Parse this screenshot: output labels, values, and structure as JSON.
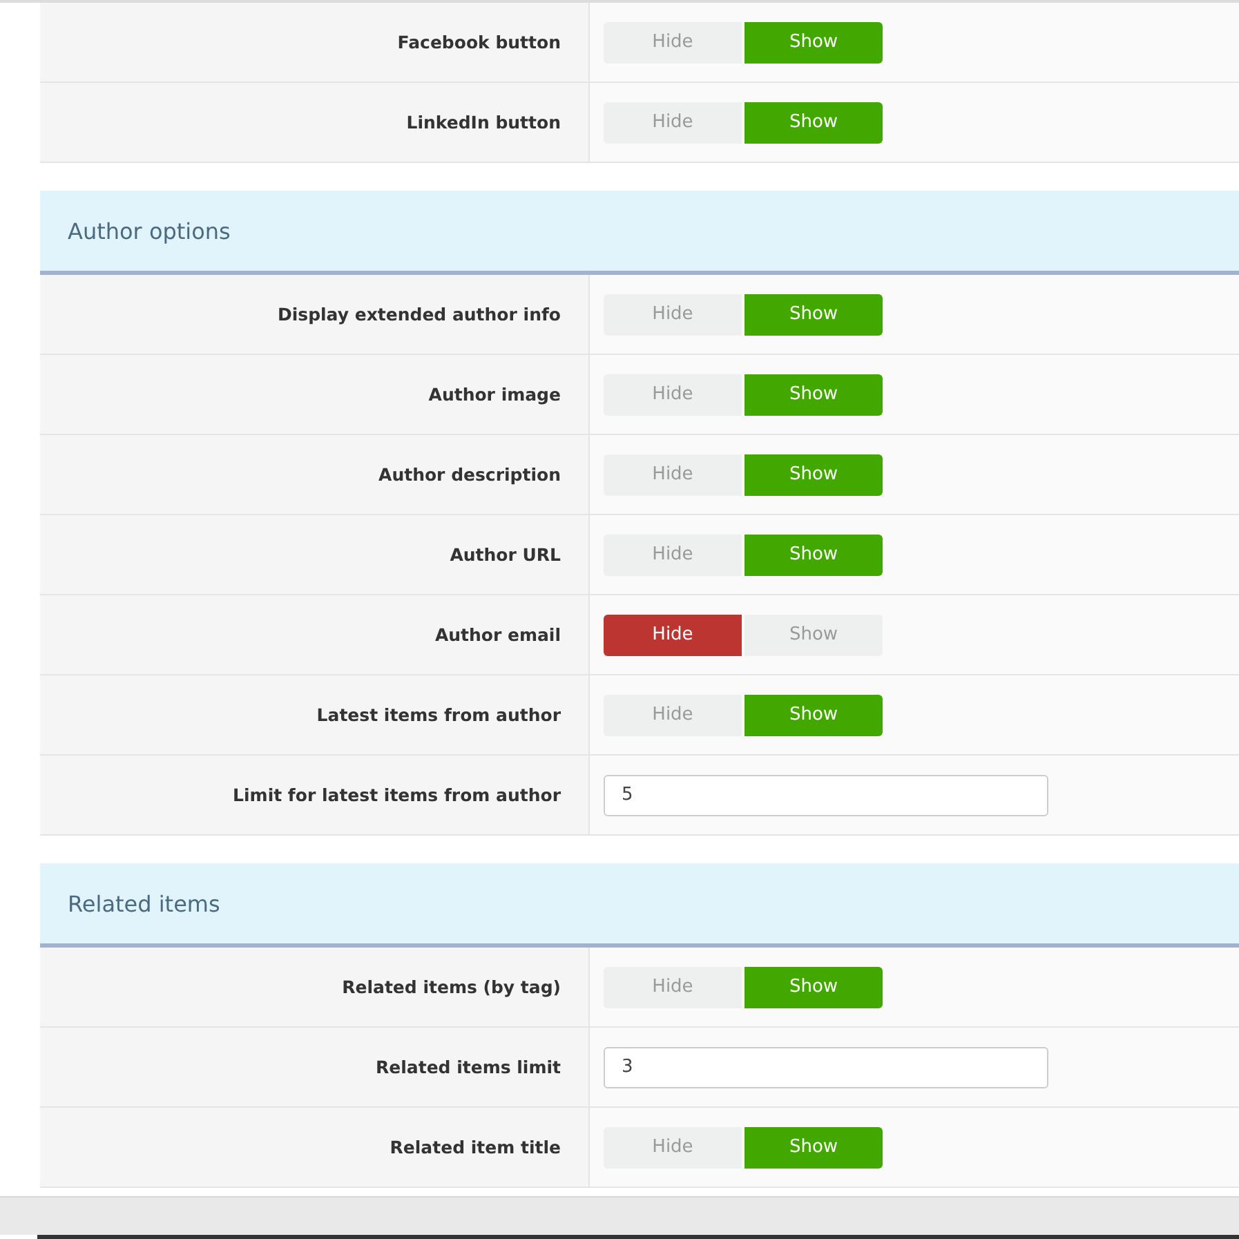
{
  "sections": [
    {
      "rows": [
        {
          "label": "Facebook button",
          "kind": "toggle",
          "options": [
            {
              "label": "Hide",
              "selected": false
            },
            {
              "label": "Show",
              "selected": true
            }
          ]
        },
        {
          "label": "LinkedIn button",
          "kind": "toggle",
          "options": [
            {
              "label": "Hide",
              "selected": false
            },
            {
              "label": "Show",
              "selected": true
            }
          ]
        }
      ]
    },
    {
      "title": "Author options",
      "rows": [
        {
          "label": "Display extended author info",
          "kind": "toggle",
          "options": [
            {
              "label": "Hide",
              "selected": false
            },
            {
              "label": "Show",
              "selected": true
            }
          ]
        },
        {
          "label": "Author image",
          "kind": "toggle",
          "options": [
            {
              "label": "Hide",
              "selected": false
            },
            {
              "label": "Show",
              "selected": true
            }
          ]
        },
        {
          "label": "Author description",
          "kind": "toggle",
          "options": [
            {
              "label": "Hide",
              "selected": false
            },
            {
              "label": "Show",
              "selected": true
            }
          ]
        },
        {
          "label": "Author URL",
          "kind": "toggle",
          "options": [
            {
              "label": "Hide",
              "selected": false
            },
            {
              "label": "Show",
              "selected": true
            }
          ]
        },
        {
          "label": "Author email",
          "kind": "toggle",
          "options": [
            {
              "label": "Hide",
              "selected": true
            },
            {
              "label": "Show",
              "selected": false
            }
          ]
        },
        {
          "label": "Latest items from author",
          "kind": "toggle",
          "options": [
            {
              "label": "Hide",
              "selected": false
            },
            {
              "label": "Show",
              "selected": true
            }
          ]
        },
        {
          "label": "Limit for latest items from author",
          "kind": "text",
          "value": "5"
        }
      ]
    },
    {
      "title": "Related items",
      "rows": [
        {
          "label": "Related items (by tag)",
          "kind": "toggle",
          "options": [
            {
              "label": "Hide",
              "selected": false
            },
            {
              "label": "Show",
              "selected": true
            }
          ]
        },
        {
          "label": "Related items limit",
          "kind": "text",
          "value": "3"
        },
        {
          "label": "Related item title",
          "kind": "toggle",
          "options": [
            {
              "label": "Hide",
              "selected": false
            },
            {
              "label": "Show",
              "selected": true
            }
          ]
        }
      ]
    }
  ]
}
